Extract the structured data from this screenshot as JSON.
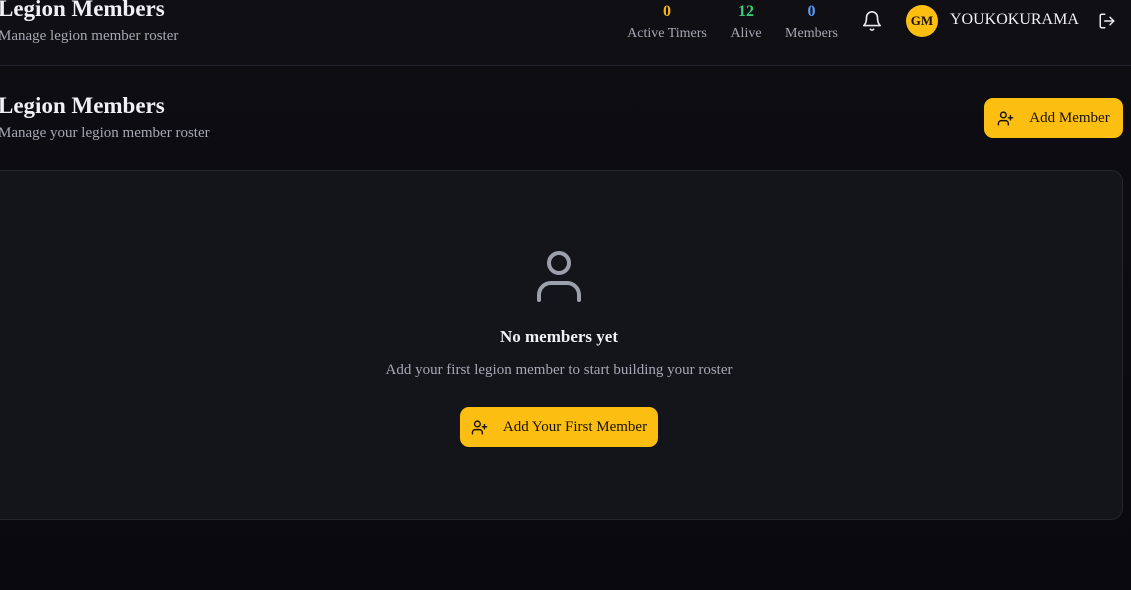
{
  "header": {
    "title": "Legion Members",
    "subtitle": "Manage legion member roster",
    "stats": [
      {
        "value": "0",
        "label": "Active Timers",
        "color": "#f5b316"
      },
      {
        "value": "12",
        "label": "Alive",
        "color": "#34d17a"
      },
      {
        "value": "0",
        "label": "Members",
        "color": "#5b9bf5"
      }
    ],
    "avatar_initials": "GM",
    "username": "YOUKOKURAMA"
  },
  "page": {
    "title": "Legion Members",
    "subtitle": "Manage your legion member roster",
    "add_button_label": "Add Member"
  },
  "empty_state": {
    "title": "No members yet",
    "text": "Add your first legion member to start building your roster",
    "button_label": "Add Your First Member"
  },
  "colors": {
    "accent": "#fbbe11",
    "background": "#0b0a10",
    "card": "#14141b"
  },
  "icons": {
    "bell": "bell-icon",
    "logout": "logout-icon",
    "user_plus": "user-plus-icon",
    "user": "user-icon"
  }
}
